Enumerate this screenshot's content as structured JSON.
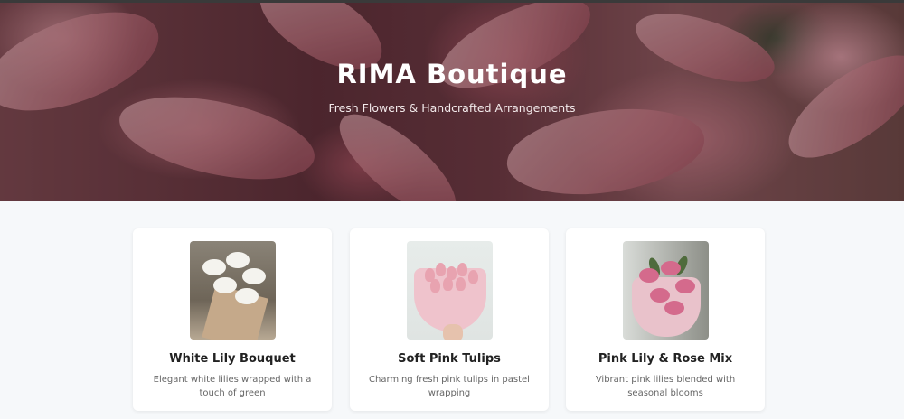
{
  "hero": {
    "title": "RIMA Boutique",
    "subtitle": "Fresh Flowers & Handcrafted Arrangements"
  },
  "products": [
    {
      "title": "White Lily Bouquet",
      "description": "Elegant white lilies wrapped with a touch of green"
    },
    {
      "title": "Soft Pink Tulips",
      "description": "Charming fresh pink tulips in pastel wrapping"
    },
    {
      "title": "Pink Lily & Rose Mix",
      "description": "Vibrant pink lilies blended with seasonal blooms"
    }
  ],
  "colors": {
    "page_background": "#f6f8fa",
    "card_background": "#ffffff",
    "title_text": "#222222",
    "description_text": "#666666"
  }
}
